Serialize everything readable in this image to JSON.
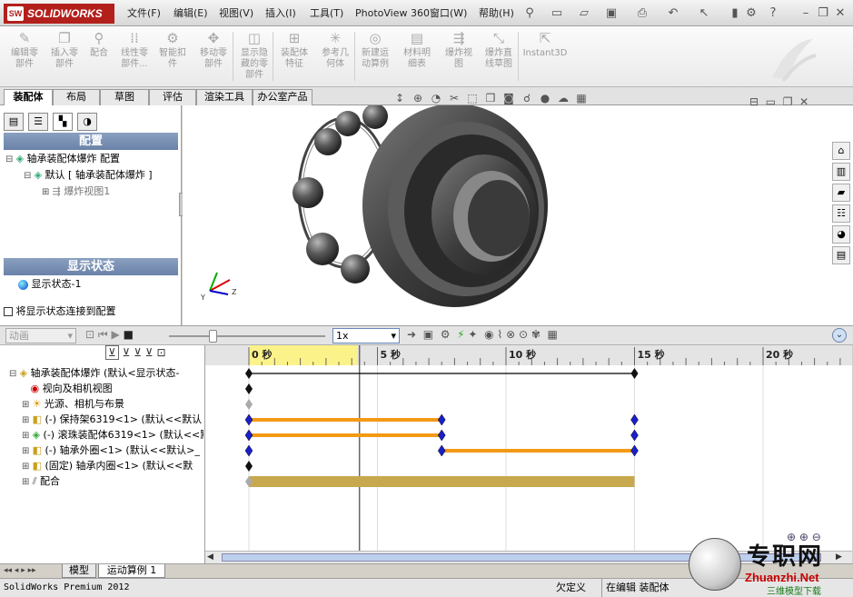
{
  "app": {
    "logo": "SOLIDWORKS",
    "logo_badge": "SW"
  },
  "menu": [
    "文件(F)",
    "编辑(E)",
    "视图(V)",
    "插入(I)",
    "工具(T)",
    "PhotoView 360",
    "窗口(W)",
    "帮助(H)"
  ],
  "ribbon": [
    {
      "label": "编辑零\n部件",
      "icon": "edit-component-icon",
      "glyph": "✎"
    },
    {
      "label": "插入零\n部件",
      "icon": "insert-component-icon",
      "glyph": "❐"
    },
    {
      "label": "配合",
      "icon": "mate-icon",
      "glyph": "⚲"
    },
    {
      "label": "线性零\n部件...",
      "icon": "linear-pattern-icon",
      "glyph": "⁞⁞"
    },
    {
      "label": "智能扣\n件",
      "icon": "smart-fastener-icon",
      "glyph": "⚙"
    },
    {
      "label": "移动零\n部件",
      "icon": "move-component-icon",
      "glyph": "✥"
    },
    {
      "label": "显示隐\n藏的零\n部件",
      "icon": "show-hidden-icon",
      "glyph": "◫"
    },
    {
      "label": "装配体\n特征",
      "icon": "assembly-feature-icon",
      "glyph": "⊞"
    },
    {
      "label": "参考几\n何体",
      "icon": "reference-geometry-icon",
      "glyph": "✳"
    },
    {
      "label": "新建运\n动算例",
      "icon": "new-motion-study-icon",
      "glyph": "◎"
    },
    {
      "label": "材料明\n细表",
      "icon": "bom-icon",
      "glyph": "▤"
    },
    {
      "label": "爆炸视\n图",
      "icon": "exploded-view-icon",
      "glyph": "⇶"
    },
    {
      "label": "爆炸直\n线草图",
      "icon": "explode-line-sketch-icon",
      "glyph": "⤡"
    },
    {
      "label": "Instant3D",
      "icon": "instant3d-icon",
      "glyph": "⇱"
    }
  ],
  "tabs": [
    "装配体",
    "布局",
    "草图",
    "评估",
    "渲染工具",
    "办公室产品"
  ],
  "config": {
    "header": "配置",
    "items": [
      {
        "text": "轴承装配体爆炸  配置",
        "indent": 0,
        "expand": "⊟"
      },
      {
        "text": "默认 [ 轴承装配体爆炸 ]",
        "indent": 1,
        "expand": "⊟"
      },
      {
        "text": "爆炸视图1",
        "indent": 2,
        "expand": "⊞"
      }
    ]
  },
  "display_state": {
    "header": "显示状态",
    "item": "显示状态-1",
    "link_label": "将显示状态连接到配置"
  },
  "motion": {
    "type": "动画",
    "speed": "1x"
  },
  "timeline": {
    "labels": [
      "0 秒",
      "5 秒",
      "10 秒",
      "15 秒",
      "20 秒"
    ],
    "ticks": [
      0,
      5,
      10,
      15,
      20
    ],
    "end": 15,
    "marker": 4.3
  },
  "motion_tree": [
    {
      "text": "轴承装配体爆炸   (默认<显示状态-",
      "expand": "⊟",
      "indent": 0,
      "icon": "assembly-icon",
      "track": {
        "type": "line",
        "from": 0,
        "to": 15,
        "color": "#000000"
      }
    },
    {
      "text": "视向及相机视图",
      "expand": "",
      "indent": 1,
      "icon": "camera-view-icon",
      "track": {
        "type": "key",
        "at": 0
      }
    },
    {
      "text": "光源、相机与布景",
      "expand": "⊞",
      "indent": 1,
      "icon": "lights-icon",
      "track": {
        "type": "gkey",
        "at": 0
      }
    },
    {
      "text": "(-) 保持架6319<1> (默认<<默认",
      "expand": "⊞",
      "indent": 1,
      "icon": "part-icon",
      "track": {
        "type": "bar",
        "from": 0,
        "to": 7.5,
        "end": 15,
        "color": "#f39a15"
      }
    },
    {
      "text": "(-) 滚珠装配体6319<1> (默认<<默",
      "expand": "⊞",
      "indent": 1,
      "icon": "subassembly-icon",
      "track": {
        "type": "bar",
        "from": 0,
        "to": 7.5,
        "end": 15,
        "color": "#f39a15"
      }
    },
    {
      "text": "(-) 轴承外圈<1> (默认<<默认>_",
      "expand": "⊞",
      "indent": 1,
      "icon": "part-icon",
      "track": {
        "type": "bar",
        "from": 7.5,
        "to": 15,
        "start": 0,
        "color": "#f39a15"
      }
    },
    {
      "text": "(固定) 轴承内圈<1> (默认<<默",
      "expand": "⊞",
      "indent": 1,
      "icon": "part-icon",
      "track": {
        "type": "key",
        "at": 0
      }
    },
    {
      "text": "配合",
      "expand": "⊞",
      "indent": 1,
      "icon": "mates-icon",
      "track": {
        "type": "gold",
        "from": 0,
        "to": 15,
        "color": "#c8a84e"
      }
    }
  ],
  "bottom_tabs": [
    "模型",
    "运动算例 1"
  ],
  "status": {
    "left": "SolidWorks Premium 2012",
    "state": "欠定义",
    "mode": "在编辑 装配体"
  },
  "watermark": {
    "cn": "专职网",
    "en": "Zhuanzhi.Net",
    "sub": "三维模型下载"
  },
  "colors": {
    "accent": "#b3201c",
    "header": "#6a82a8",
    "key": "#1a20c8",
    "bar": "#f39a15",
    "gold": "#c8a84e",
    "highlight": "#fbf38a"
  }
}
